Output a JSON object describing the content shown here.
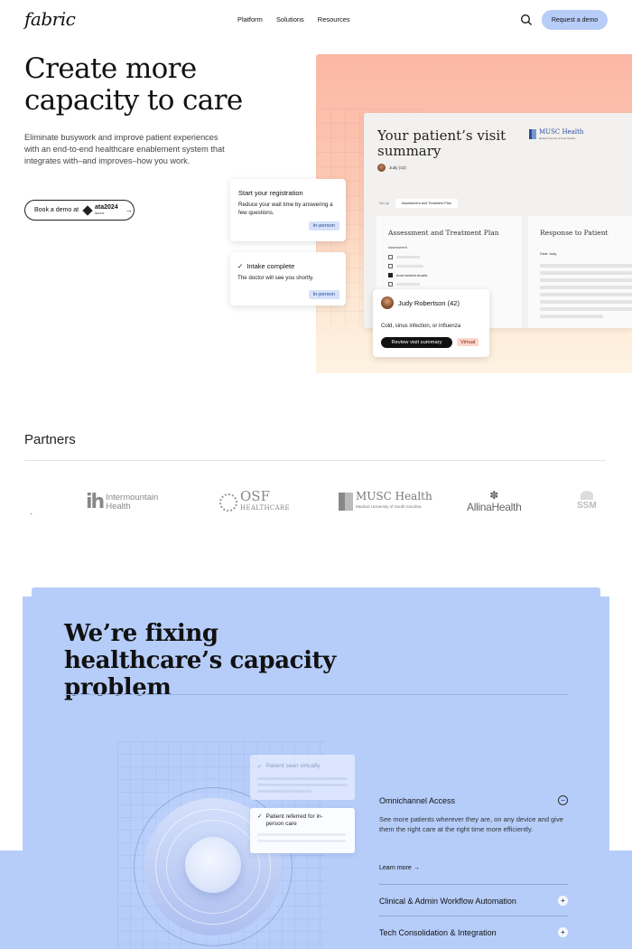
{
  "header": {
    "logo": "fabric",
    "nav": [
      "Platform",
      "Solutions",
      "Resources"
    ],
    "search_icon": "search-icon",
    "cta": "Request a demo"
  },
  "hero": {
    "title": "Create more capacity to care",
    "subtitle": "Eliminate busywork and improve patient experiences with an end-to-end healthcare enablement system that integrates with–and improves–how you work.",
    "demo_button": "Book a demo at",
    "demo_event": "ata2024",
    "demo_event_sub": "NEXUS",
    "arrow": "→"
  },
  "visit_summary": {
    "title": "Your patient’s visit summary",
    "patient_mini": "Judy (42)",
    "org": "MUSC Health",
    "org_sub": "Medical University of South Carolina",
    "tabs": [
      "Set up",
      "Assessment and Treatment Plan"
    ],
    "left_pane_title": "Assessment and Treatment Plan",
    "assessment_label": "Assessment",
    "checked_item": "Acute bacterial sinusitis",
    "right_pane_title": "Response to Patient",
    "greeting": "Dear Judy,"
  },
  "registration_card": {
    "title": "Start your registration",
    "text": "Reduce your wait time by answering a few questions.",
    "badge": "In-person"
  },
  "intake_card": {
    "check": "✓",
    "title": "Intake complete",
    "text": "The doctor will see you shortly.",
    "badge": "In-person"
  },
  "patient_card": {
    "name": "Judy Robertson (42)",
    "condition": "Cold, sinus infection, or influenza",
    "button": "Review visit summary",
    "badge": "Virtual"
  },
  "partners": {
    "title": "Partners",
    "intermountain_mark": "ih",
    "intermountain": [
      "Intermountain",
      "Health"
    ],
    "osf": "OSF",
    "osf_sub": "HEALTHCARE",
    "musc": "MUSC Health",
    "musc_sub": "Medical University of South Carolina",
    "allina_mark": "✽",
    "allina": "AllinaHealth",
    "ssm": "SSM"
  },
  "capacity": {
    "title": "We’re fixing healthcare’s capacity problem",
    "seen_card": "Patient seen virtually",
    "referred_card": "Patient referred for in-person care",
    "check": "✓",
    "accordion": {
      "active_title": "Omnichannel Access",
      "active_text": "See more patients wherever they are, on any device and give them the right care at the right time more efficiently.",
      "learn_more": "Learn more",
      "arrow": "→",
      "minus": "−",
      "plus": "+",
      "items": [
        "Clinical & Admin Workflow Automation",
        "Tech Consolidation & Integration"
      ]
    }
  },
  "colors": {
    "accent_blue": "#b6cdfa",
    "hero_peach": "#fbb7a4",
    "badge_blue": "#d6e2fb",
    "badge_peach": "#fdd7cb"
  }
}
